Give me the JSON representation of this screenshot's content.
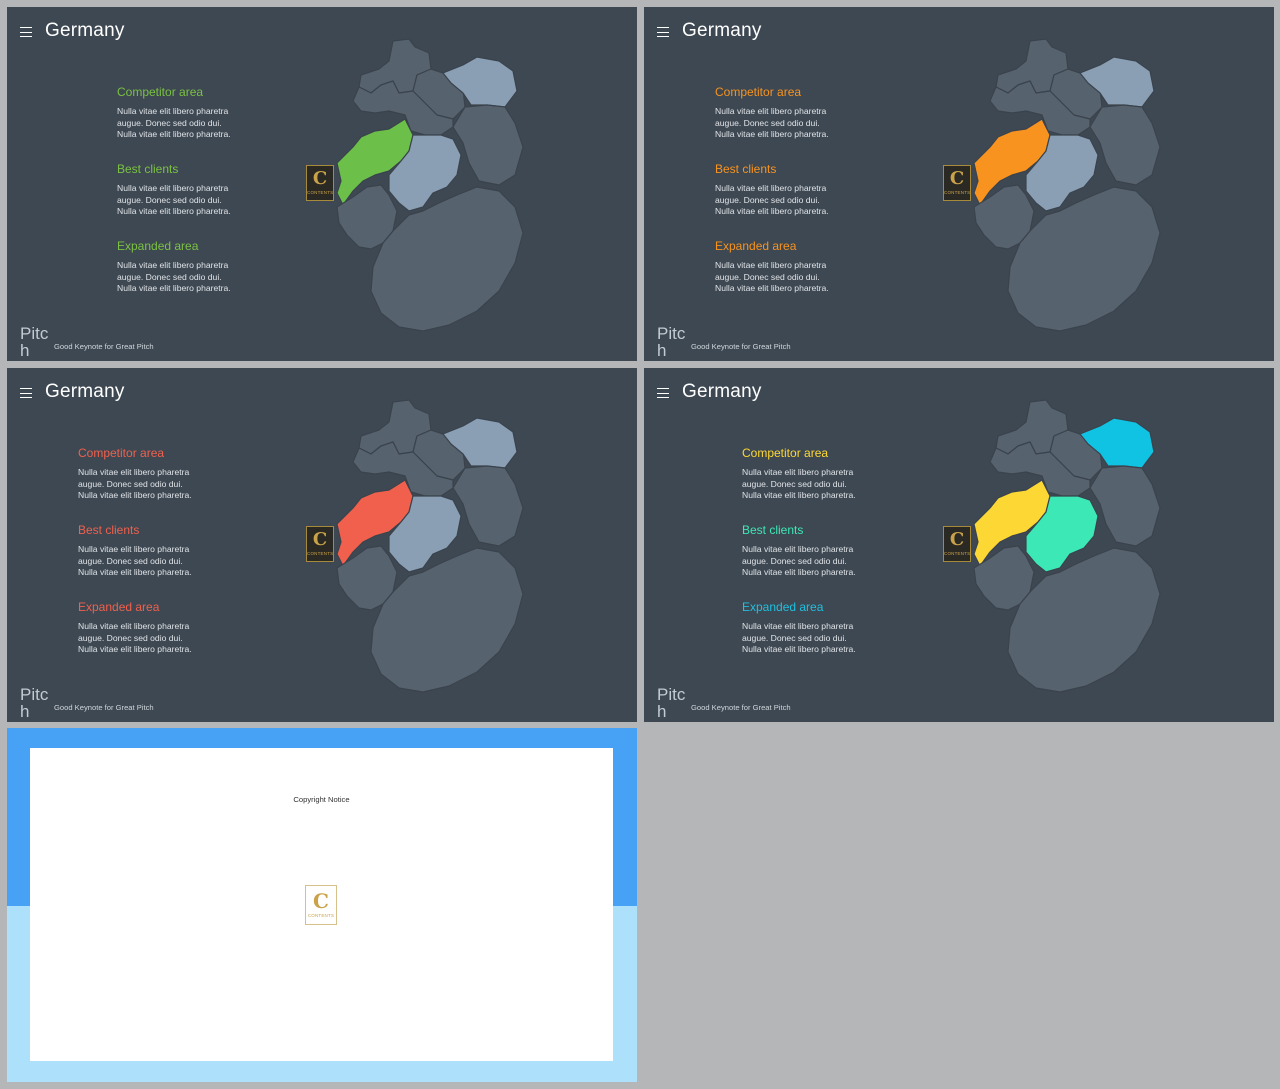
{
  "slides": [
    {
      "title": "Germany",
      "legend": [
        {
          "heading": "Competitor area",
          "color": "#7ac143",
          "body": [
            "Nulla vitae elit libero pharetra",
            "augue. Donec sed odio dui.",
            "Nulla vitae elit libero pharetra."
          ]
        },
        {
          "heading": "Best clients",
          "color": "#7ac143",
          "body": [
            "Nulla vitae elit libero pharetra",
            "augue. Donec sed odio dui.",
            "Nulla vitae elit libero pharetra."
          ]
        },
        {
          "heading": "Expanded area",
          "color": "#7ac143",
          "body": [
            "Nulla vitae elit libero pharetra",
            "augue. Donec sed odio dui.",
            "Nulla vitae elit libero pharetra."
          ]
        }
      ],
      "map_colors": {
        "base": "#56626e",
        "northeast": "#8a9fb4",
        "west": "#6cc04a",
        "center": "#8a9fb4"
      },
      "logo": {
        "letter": "C",
        "word": "CONTENTS"
      },
      "footer": {
        "brand": "Pitch",
        "tagline": "Good Keynote for Great Pitch"
      }
    },
    {
      "title": "Germany",
      "legend": [
        {
          "heading": "Competitor area",
          "color": "#f7931e",
          "body": [
            "Nulla vitae elit libero pharetra",
            "augue. Donec sed odio dui.",
            "Nulla vitae elit libero pharetra."
          ]
        },
        {
          "heading": "Best clients",
          "color": "#f7931e",
          "body": [
            "Nulla vitae elit libero pharetra",
            "augue. Donec sed odio dui.",
            "Nulla vitae elit libero pharetra."
          ]
        },
        {
          "heading": "Expanded area",
          "color": "#f7931e",
          "body": [
            "Nulla vitae elit libero pharetra",
            "augue. Donec sed odio dui.",
            "Nulla vitae elit libero pharetra."
          ]
        }
      ],
      "map_colors": {
        "base": "#56626e",
        "northeast": "#8a9fb4",
        "west": "#f7931e",
        "center": "#8a9fb4"
      },
      "logo": {
        "letter": "C",
        "word": "CONTENTS"
      },
      "footer": {
        "brand": "Pitch",
        "tagline": "Good Keynote for Great Pitch"
      }
    },
    {
      "title": "Germany",
      "legend": [
        {
          "heading": "Competitor area",
          "color": "#f0604d",
          "body": [
            "Nulla vitae elit libero pharetra",
            "augue. Donec sed odio dui.",
            "Nulla vitae elit libero pharetra."
          ]
        },
        {
          "heading": "Best clients",
          "color": "#f0604d",
          "body": [
            "Nulla vitae elit libero pharetra",
            "augue. Donec sed odio dui.",
            "Nulla vitae elit libero pharetra."
          ]
        },
        {
          "heading": "Expanded area",
          "color": "#f0604d",
          "body": [
            "Nulla vitae elit libero pharetra",
            "augue. Donec sed odio dui.",
            "Nulla vitae elit libero pharetra."
          ]
        }
      ],
      "map_colors": {
        "base": "#56626e",
        "northeast": "#8a9fb4",
        "west": "#f0604d",
        "center": "#8a9fb4"
      },
      "logo": {
        "letter": "C",
        "word": "CONTENTS"
      },
      "footer": {
        "brand": "Pitch",
        "tagline": "Good Keynote for Great Pitch"
      }
    },
    {
      "title": "Germany",
      "legend": [
        {
          "heading": "Competitor area",
          "color": "#fdd835",
          "body": [
            "Nulla vitae elit libero pharetra",
            "augue. Donec sed odio dui.",
            "Nulla vitae elit libero pharetra."
          ]
        },
        {
          "heading": "Best clients",
          "color": "#3ce8b5",
          "body": [
            "Nulla vitae elit libero pharetra",
            "augue. Donec sed odio dui.",
            "Nulla vitae elit libero pharetra."
          ]
        },
        {
          "heading": "Expanded area",
          "color": "#20c0e0",
          "body": [
            "Nulla vitae elit libero pharetra",
            "augue. Donec sed odio dui.",
            "Nulla vitae elit libero pharetra."
          ]
        }
      ],
      "map_colors": {
        "base": "#56626e",
        "northeast": "#10c3e3",
        "west": "#fdd835",
        "center": "#3ce8b5"
      },
      "logo": {
        "letter": "C",
        "word": "CONTENTS"
      },
      "footer": {
        "brand": "Pitch",
        "tagline": "Good Keynote for Great Pitch"
      }
    }
  ],
  "copyright": {
    "text": "Copyright Notice",
    "logo": {
      "letter": "C",
      "word": "CONTENTS"
    }
  },
  "colors": {
    "page_background": "#b4b6b8",
    "slide_background": "#3e4852",
    "copyright_top": "#47a2f5",
    "copyright_bottom": "#ade0fb"
  }
}
